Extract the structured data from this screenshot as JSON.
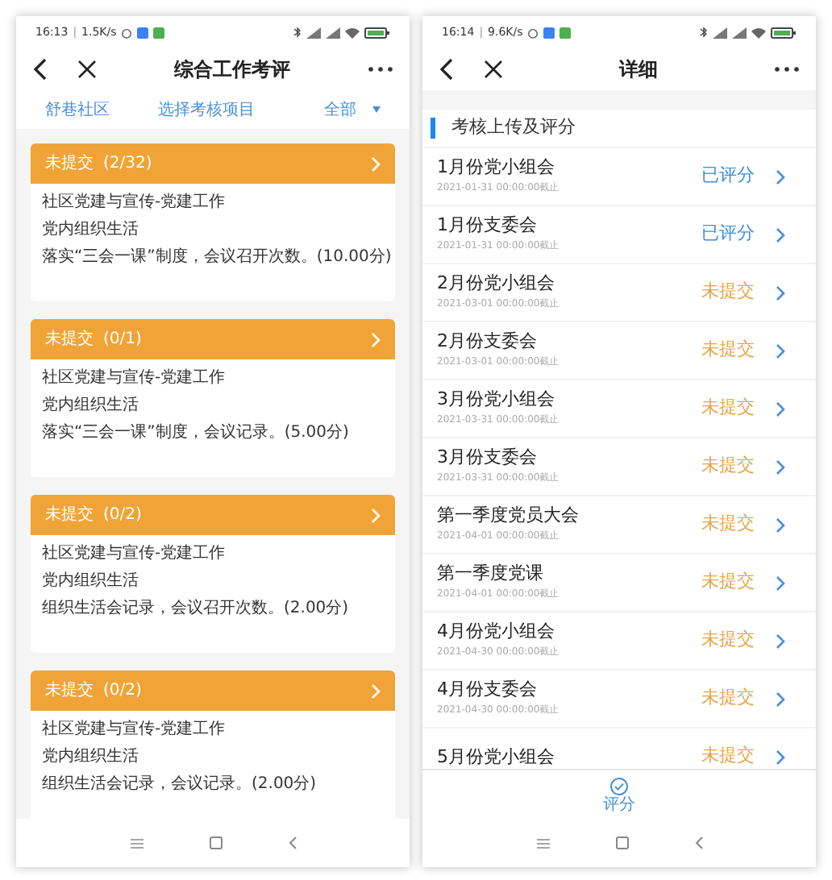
{
  "left_screen": {
    "status_bar": {
      "time": "16:13",
      "separator": "|",
      "speed": "1.5K/s"
    },
    "title": "综合工作考评",
    "filters": [
      {
        "label": "舒巷社区"
      },
      {
        "label": "选择考核项目"
      },
      {
        "label": "全部",
        "dropdown": true
      }
    ],
    "cards": [
      {
        "status": "未提交",
        "count": "(2/32)",
        "lines": [
          "社区党建与宣传-党建工作",
          "党内组织生活",
          "落实“三会一课”制度，会议召开次数。(10.00分)"
        ]
      },
      {
        "status": "未提交",
        "count": "(0/1)",
        "lines": [
          "社区党建与宣传-党建工作",
          "党内组织生活",
          "落实“三会一课”制度，会议记录。(5.00分)"
        ]
      },
      {
        "status": "未提交",
        "count": "(0/2)",
        "lines": [
          "社区党建与宣传-党建工作",
          "党内组织生活",
          "组织生活会记录，会议召开次数。(2.00分)"
        ]
      },
      {
        "status": "未提交",
        "count": "(0/2)",
        "lines": [
          "社区党建与宣传-党建工作",
          "党内组织生活",
          "组织生活会记录，会议记录。(2.00分)"
        ]
      }
    ]
  },
  "right_screen": {
    "status_bar": {
      "time": "16:14",
      "separator": "|",
      "speed": "9.6K/s"
    },
    "title": "详细",
    "section_title": "考核上传及评分",
    "rows": [
      {
        "name": "1月份党小组会",
        "deadline": "2021-01-31 00:00:00截止",
        "status": "已评分",
        "kind": "rated"
      },
      {
        "name": "1月份支委会",
        "deadline": "2021-01-31 00:00:00截止",
        "status": "已评分",
        "kind": "rated"
      },
      {
        "name": "2月份党小组会",
        "deadline": "2021-03-01 00:00:00截止",
        "status": "未提交",
        "kind": "pending"
      },
      {
        "name": "2月份支委会",
        "deadline": "2021-03-01 00:00:00截止",
        "status": "未提交",
        "kind": "pending"
      },
      {
        "name": "3月份党小组会",
        "deadline": "2021-03-31 00:00:00截止",
        "status": "未提交",
        "kind": "pending"
      },
      {
        "name": "3月份支委会",
        "deadline": "2021-03-31 00:00:00截止",
        "status": "未提交",
        "kind": "pending"
      },
      {
        "name": "第一季度党员大会",
        "deadline": "2021-04-01 00:00:00截止",
        "status": "未提交",
        "kind": "pending"
      },
      {
        "name": "第一季度党课",
        "deadline": "2021-04-01 00:00:00截止",
        "status": "未提交",
        "kind": "pending"
      },
      {
        "name": "4月份党小组会",
        "deadline": "2021-04-30 00:00:00截止",
        "status": "未提交",
        "kind": "pending"
      },
      {
        "name": "4月份支委会",
        "deadline": "2021-04-30 00:00:00截止",
        "status": "未提交",
        "kind": "pending"
      },
      {
        "name": "5月份党小组会",
        "status": "未提交",
        "kind": "pending"
      }
    ],
    "tab_bar": [
      {
        "label": "评分",
        "selected": true
      }
    ]
  }
}
